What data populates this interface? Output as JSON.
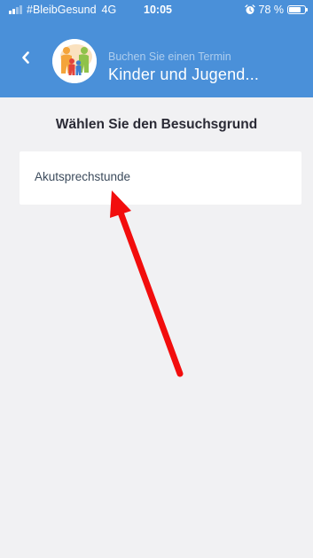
{
  "status_bar": {
    "carrier": "#BleibGesund",
    "network": "4G",
    "time": "10:05",
    "battery_percent": "78 %",
    "battery_level": 0.78,
    "icons": [
      "signal-icon",
      "alarm-icon",
      "battery-icon"
    ]
  },
  "header": {
    "subtitle": "Buchen Sie einen Termin",
    "title": "Kinder und Jugend...",
    "back_icon": "chevron-left-icon",
    "logo_icon": "family-logo-icon"
  },
  "main": {
    "heading": "Wählen Sie den Besuchsgrund",
    "reasons": [
      {
        "label": "Akutsprechstunde"
      }
    ]
  },
  "annotation": {
    "type": "arrow",
    "color": "#f20d0d"
  },
  "colors": {
    "header_background": "#4a90d9",
    "page_background": "#f1f1f3",
    "card_background": "#ffffff",
    "heading_text": "#2a2a35",
    "card_text": "#3c4b5c"
  }
}
